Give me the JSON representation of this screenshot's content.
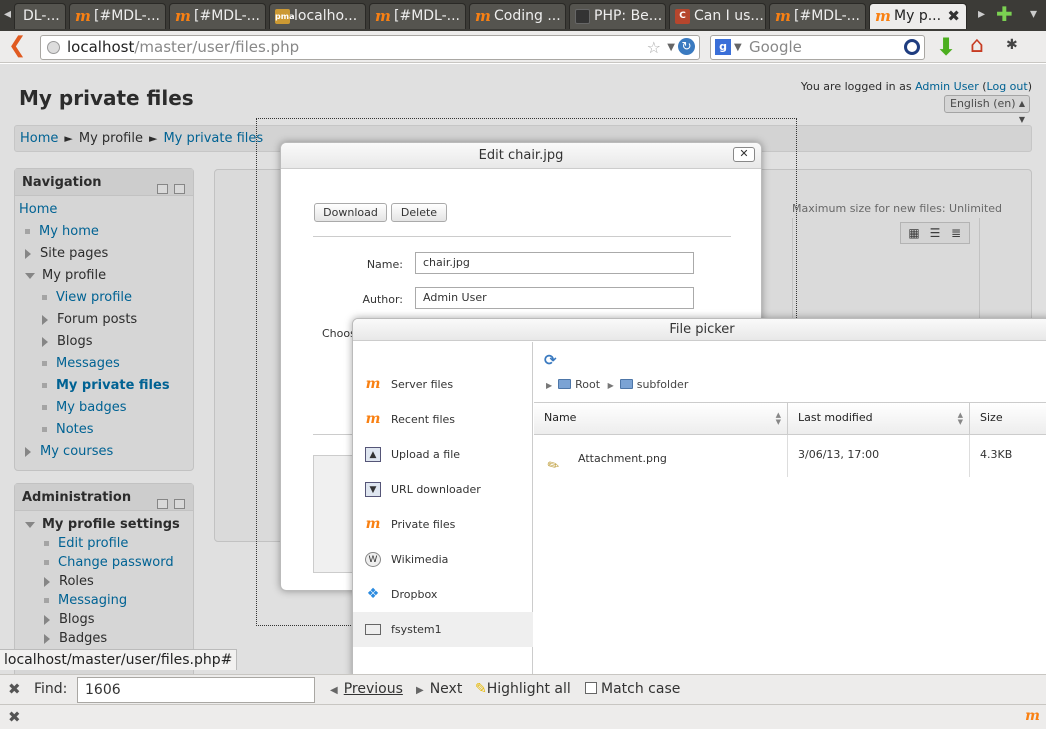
{
  "browser": {
    "tabs": [
      {
        "label": "DL-...",
        "icon": "moodle"
      },
      {
        "label": "[#MDL-...",
        "icon": "moodle"
      },
      {
        "label": "[#MDL-...",
        "icon": "moodle"
      },
      {
        "label": "localho...",
        "icon": "pma"
      },
      {
        "label": "[#MDL-...",
        "icon": "moodle"
      },
      {
        "label": "Coding ...",
        "icon": "moodle"
      },
      {
        "label": "PHP: Be...",
        "icon": "php"
      },
      {
        "label": "Can I us...",
        "icon": "ciu"
      },
      {
        "label": "[#MDL-...",
        "icon": "moodle"
      },
      {
        "label": "My p...",
        "icon": "moodle"
      }
    ],
    "url_host": "localhost",
    "url_path": "/master/user/files.php",
    "search_placeholder": "Google"
  },
  "header": {
    "title": "My private files",
    "logged_in_prefix": "You are logged in as",
    "user_name": "Admin User",
    "logout_label": "Log out",
    "language": "English (en)"
  },
  "breadcrumb": [
    "Home",
    "My profile",
    "My private files"
  ],
  "navigation": {
    "title": "Navigation",
    "items": [
      {
        "label": "Home"
      },
      {
        "label": "My home"
      },
      {
        "label": "Site pages"
      },
      {
        "label": "My profile"
      },
      {
        "label": "View profile"
      },
      {
        "label": "Forum posts"
      },
      {
        "label": "Blogs"
      },
      {
        "label": "Messages"
      },
      {
        "label": "My private files"
      },
      {
        "label": "My badges"
      },
      {
        "label": "Notes"
      },
      {
        "label": "My courses"
      }
    ]
  },
  "administration": {
    "title": "Administration",
    "items": [
      {
        "label": "My profile settings"
      },
      {
        "label": "Edit profile"
      },
      {
        "label": "Change password"
      },
      {
        "label": "Roles"
      },
      {
        "label": "Messaging"
      },
      {
        "label": "Blogs"
      },
      {
        "label": "Badges"
      }
    ]
  },
  "filemanager": {
    "max_size": "Maximum size for new files: Unlimited"
  },
  "edit_dialog": {
    "title": "Edit chair.jpg",
    "download_label": "Download",
    "delete_label": "Delete",
    "name_label": "Name:",
    "name_value": "chair.jpg",
    "author_label": "Author:",
    "author_value": "Admin User",
    "choose_label": "Choos"
  },
  "file_picker": {
    "title": "File picker",
    "repositories": [
      {
        "label": "Server files",
        "icon": "moodle-icon"
      },
      {
        "label": "Recent files",
        "icon": "moodle-icon"
      },
      {
        "label": "Upload a file",
        "icon": "upload-icon"
      },
      {
        "label": "URL downloader",
        "icon": "download-icon"
      },
      {
        "label": "Private files",
        "icon": "moodle-icon"
      },
      {
        "label": "Wikimedia",
        "icon": "wikimedia-icon"
      },
      {
        "label": "Dropbox",
        "icon": "dropbox-icon"
      },
      {
        "label": "fsystem1",
        "icon": "filesystem-icon"
      }
    ],
    "path": [
      "Root",
      "subfolder"
    ],
    "columns": {
      "name": "Name",
      "modified": "Last modified",
      "size": "Size"
    },
    "rows": [
      {
        "name": "Attachment.png",
        "modified": "3/06/13, 17:00",
        "size": "4.3KB"
      }
    ]
  },
  "status_url": "localhost/master/user/files.php#",
  "findbar": {
    "label": "Find:",
    "value": "1606",
    "previous": "Previous",
    "next": "Next",
    "highlight": "Highlight all",
    "match_case": "Match case"
  }
}
